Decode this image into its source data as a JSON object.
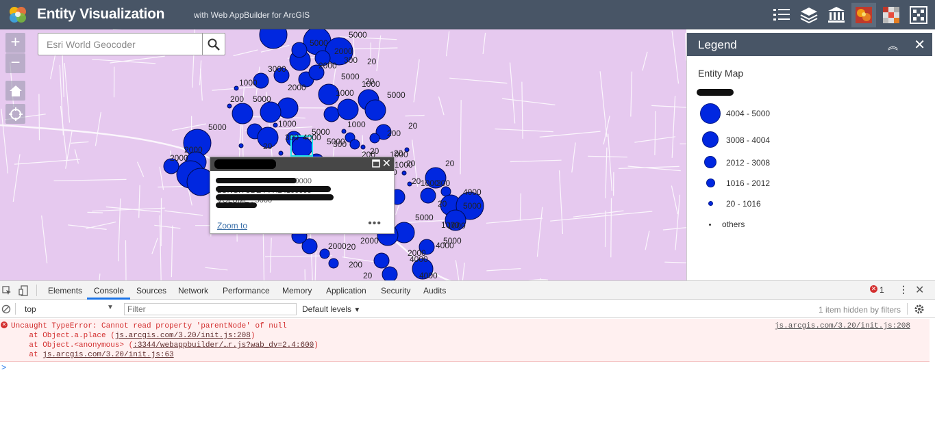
{
  "header": {
    "title": "Entity Visualization",
    "subtitle": "with Web AppBuilder for ArcGIS",
    "buttons": [
      "legend-list-icon",
      "layers-icon",
      "basemap-gallery-icon",
      "heatmap-icon",
      "grid-icon",
      "tile-icon"
    ]
  },
  "map": {
    "zoom_in": "+",
    "zoom_out": "−",
    "search": {
      "placeholder": "Esri World Geocoder"
    },
    "labels": [
      "5000",
      "5000",
      "2000",
      "300",
      "20",
      "3000",
      "2000",
      "1000",
      "5000",
      "20",
      "2000",
      "1000",
      "5000",
      "1000",
      "200",
      "5000",
      "1000",
      "5000",
      "20",
      "5000",
      "1000",
      "20",
      "300",
      "20",
      "5000",
      "2000",
      "2000",
      "300",
      "20",
      "4000",
      "200",
      "1000",
      "20",
      "1000",
      "300",
      "20",
      "4000",
      "20",
      "5000",
      "1000",
      "4000",
      "5000",
      "1000",
      "5000",
      "4000",
      "2000",
      "200",
      "2000",
      "4000",
      "1000",
      "2000",
      "20",
      "20",
      "200",
      "4000",
      "20"
    ],
    "popup": {
      "zoom_to": "Zoom to",
      "more": "•••",
      "lines": [
        "LATITUDE : 28.5658730000",
        "LONGITUDE : 77.24100000",
        "VOLUME : 5000"
      ]
    }
  },
  "legend": {
    "title": "Legend",
    "layer": "Entity Map",
    "items": [
      {
        "label": "4004 - 5000"
      },
      {
        "label": "3008 - 4004"
      },
      {
        "label": "2012 - 3008"
      },
      {
        "label": "1016 - 2012"
      },
      {
        "label": "20 - 1016"
      },
      {
        "label": "others"
      }
    ],
    "symbol_color": "#0027e0"
  },
  "devtools": {
    "tabs": [
      "Elements",
      "Console",
      "Sources",
      "Network",
      "Performance",
      "Memory",
      "Application",
      "Security",
      "Audits"
    ],
    "active_tab": "Console",
    "error_count": "1",
    "context": "top",
    "filter_placeholder": "Filter",
    "levels": "Default levels",
    "hidden": "1 item hidden by filters",
    "error": {
      "message": "Uncaught TypeError: Cannot read property 'parentNode' of null",
      "source": "js.arcgis.com/3.20/init.js:208",
      "stack": [
        {
          "prefix": "    at Object.a.place (",
          "link": "js.arcgis.com/3.20/init.js:208",
          "suffix": ")"
        },
        {
          "prefix": "    at Object.<anonymous> (",
          "link": ":3344/webappbuilder/…r.js?wab_dv=2.4:600",
          "suffix": ")"
        },
        {
          "prefix": "    at ",
          "link": "js.arcgis.com/3.20/init.js:63",
          "suffix": ""
        }
      ]
    },
    "prompt": ">"
  }
}
